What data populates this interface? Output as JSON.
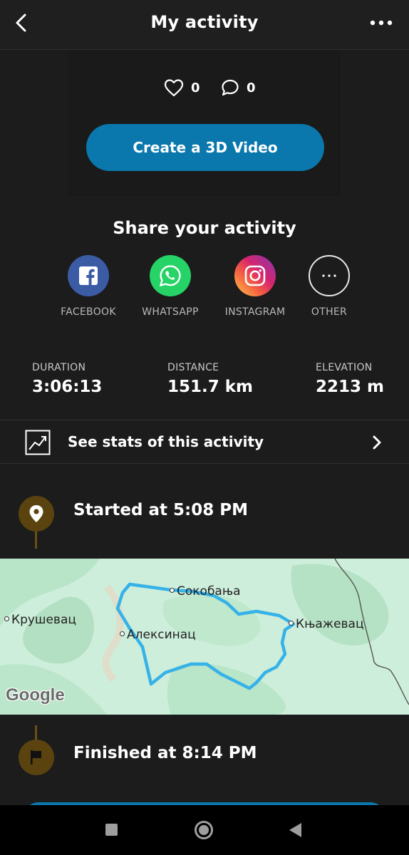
{
  "header": {
    "title": "My activity"
  },
  "reactions": {
    "likes": "0",
    "comments": "0"
  },
  "video_button": "Create a 3D Video",
  "share": {
    "title": "Share your activity",
    "items": [
      {
        "label": "FACEBOOK",
        "icon": "facebook-icon",
        "color": "#3b5ba5"
      },
      {
        "label": "WHATSAPP",
        "icon": "whatsapp-icon",
        "color": "#25d366"
      },
      {
        "label": "INSTAGRAM",
        "icon": "instagram-icon",
        "color": "#d6246e"
      },
      {
        "label": "OTHER",
        "icon": "more-icon"
      }
    ]
  },
  "stats": {
    "duration": {
      "label": "DURATION",
      "value": "3:06:13"
    },
    "distance": {
      "label": "DISTANCE",
      "value": "151.7 km"
    },
    "elevation": {
      "label": "ELEVATION",
      "value": "2213 m"
    },
    "see_stats": "See stats of this activity"
  },
  "timeline": {
    "started": "Started at 5:08 PM",
    "finished": "Finished at 8:14 PM"
  },
  "map": {
    "cities": [
      "Сокобања",
      "Крушевац",
      "Алексинац",
      "Књажевац"
    ],
    "attribution": "Google",
    "route_color": "#35b2e8"
  },
  "colors": {
    "accent": "#0a78ad",
    "background": "#1c1c1c",
    "timeline": "#5a430f"
  }
}
